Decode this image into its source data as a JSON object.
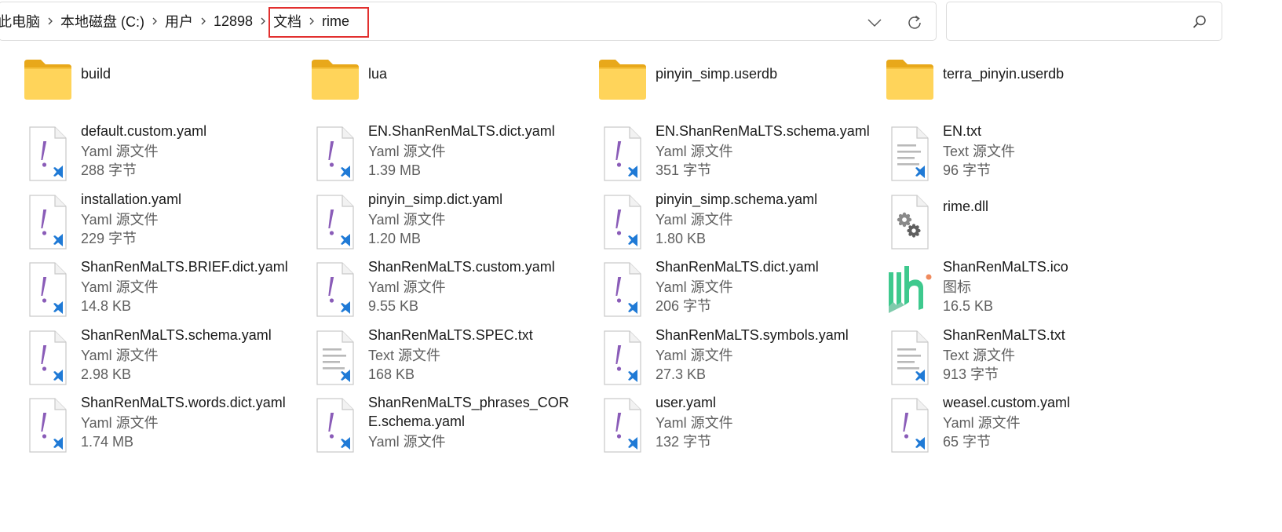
{
  "breadcrumb": {
    "items": [
      "此电脑",
      "本地磁盘 (C:)",
      "用户",
      "12898",
      "文档",
      "rime"
    ]
  },
  "search": {
    "placeholder": ""
  },
  "accent": {
    "highlight": "#e2302f",
    "yaml_mark": "#8a5cb8",
    "vscode_badge": "#1f7ad6"
  },
  "files": [
    {
      "name": "build",
      "kind": "folder",
      "type": "",
      "size": ""
    },
    {
      "name": "lua",
      "kind": "folder",
      "type": "",
      "size": ""
    },
    {
      "name": "pinyin_simp.userdb",
      "kind": "folder",
      "type": "",
      "size": ""
    },
    {
      "name": "terra_pinyin.userdb",
      "kind": "folder",
      "type": "",
      "size": ""
    },
    {
      "name": "default.custom.yaml",
      "kind": "yaml",
      "type": "Yaml 源文件",
      "size": "288 字节"
    },
    {
      "name": "EN.ShanRenMaLTS.dict.yaml",
      "kind": "yaml",
      "type": "Yaml 源文件",
      "size": "1.39 MB"
    },
    {
      "name": "EN.ShanRenMaLTS.schema.yaml",
      "kind": "yaml",
      "type": "Yaml 源文件",
      "size": "351 字节"
    },
    {
      "name": "EN.txt",
      "kind": "text",
      "type": "Text 源文件",
      "size": "96 字节"
    },
    {
      "name": "installation.yaml",
      "kind": "yaml",
      "type": "Yaml 源文件",
      "size": "229 字节"
    },
    {
      "name": "pinyin_simp.dict.yaml",
      "kind": "yaml",
      "type": "Yaml 源文件",
      "size": "1.20 MB"
    },
    {
      "name": "pinyin_simp.schema.yaml",
      "kind": "yaml",
      "type": "Yaml 源文件",
      "size": "1.80 KB"
    },
    {
      "name": "rime.dll",
      "kind": "dll",
      "type": "",
      "size": ""
    },
    {
      "name": "ShanRenMaLTS.BRIEF.dict.yaml",
      "kind": "yaml",
      "type": "Yaml 源文件",
      "size": "14.8 KB"
    },
    {
      "name": "ShanRenMaLTS.custom.yaml",
      "kind": "yaml",
      "type": "Yaml 源文件",
      "size": "9.55 KB"
    },
    {
      "name": "ShanRenMaLTS.dict.yaml",
      "kind": "yaml",
      "type": "Yaml 源文件",
      "size": "206 字节"
    },
    {
      "name": "ShanRenMaLTS.ico",
      "kind": "ico",
      "type": "图标",
      "size": "16.5 KB"
    },
    {
      "name": "ShanRenMaLTS.schema.yaml",
      "kind": "yaml",
      "type": "Yaml 源文件",
      "size": "2.98 KB"
    },
    {
      "name": "ShanRenMaLTS.SPEC.txt",
      "kind": "text",
      "type": "Text 源文件",
      "size": "168 KB"
    },
    {
      "name": "ShanRenMaLTS.symbols.yaml",
      "kind": "yaml",
      "type": "Yaml 源文件",
      "size": "27.3 KB"
    },
    {
      "name": "ShanRenMaLTS.txt",
      "kind": "text",
      "type": "Text 源文件",
      "size": "913 字节"
    },
    {
      "name": "ShanRenMaLTS.words.dict.yaml",
      "kind": "yaml",
      "type": "Yaml 源文件",
      "size": "1.74 MB"
    },
    {
      "name": "ShanRenMaLTS_phrases_CORE.schema.yaml",
      "kind": "yaml",
      "type": "Yaml 源文件",
      "size": "",
      "wrap": true
    },
    {
      "name": "user.yaml",
      "kind": "yaml",
      "type": "Yaml 源文件",
      "size": "132 字节"
    },
    {
      "name": "weasel.custom.yaml",
      "kind": "yaml",
      "type": "Yaml 源文件",
      "size": "65 字节"
    }
  ]
}
